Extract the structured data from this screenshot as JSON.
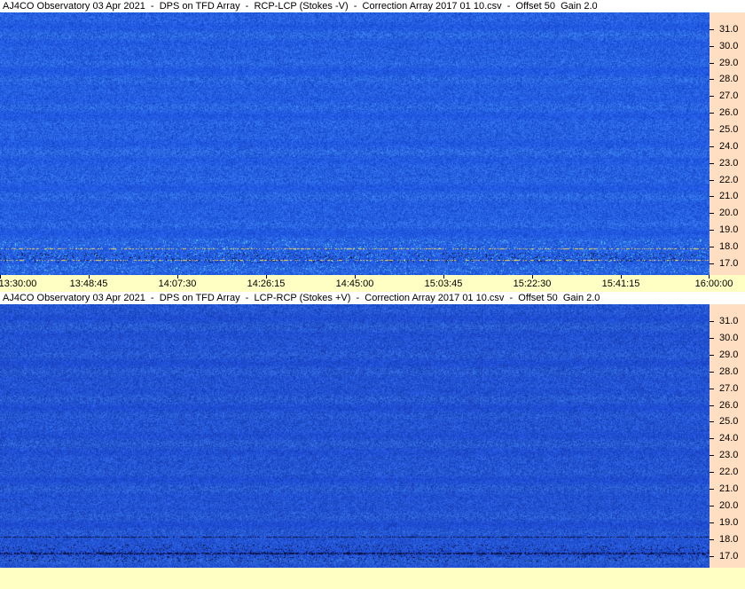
{
  "panels": [
    {
      "title": "AJ4CO Observatory 03 Apr 2021  -  DPS on TFD Array  -  RCP-LCP (Stokes -V)  -  Correction Array 2017 01 10.csv  -  Offset 50  Gain 2.0"
    },
    {
      "title": "AJ4CO Observatory 03 Apr 2021  -  DPS on TFD Array  -  LCP-RCP (Stokes +V)  -  Correction Array 2017 01 10.csv  -  Offset 50  Gain 2.0"
    }
  ],
  "chart_data": [
    {
      "type": "heatmap",
      "title": "AJ4CO Observatory 03 Apr 2021  -  DPS on TFD Array  -  RCP-LCP (Stokes -V)  -  Correction Array 2017 01 10.csv  -  Offset 50  Gain 2.0",
      "y_ticks": [
        "31.0",
        "30.0",
        "29.0",
        "28.0",
        "27.0",
        "26.0",
        "25.0",
        "24.0",
        "23.0",
        "22.0",
        "21.0",
        "20.0",
        "19.0",
        "18.0",
        "17.0"
      ],
      "y_values": [
        31,
        30,
        29,
        28,
        27,
        26,
        25,
        24,
        23,
        22,
        21,
        20,
        19,
        18,
        17
      ],
      "x_ticks": [
        "13:30:00",
        "13:48:45",
        "14:07:30",
        "14:26:15",
        "14:45:00",
        "15:03:45",
        "15:22:30",
        "15:41:15",
        "16:00:00"
      ],
      "ylim": [
        16.3,
        32.0
      ],
      "colors": {
        "base": "#1b52d9",
        "emission": "#5fc8f0",
        "strong": "#ffd24a"
      }
    },
    {
      "type": "heatmap",
      "title": "AJ4CO Observatory 03 Apr 2021  -  DPS on TFD Array  -  LCP-RCP (Stokes +V)  -  Correction Array 2017 01 10.csv  -  Offset 50  Gain 2.0",
      "y_ticks": [
        "31.0",
        "30.0",
        "29.0",
        "28.0",
        "27.0",
        "26.0",
        "25.0",
        "24.0",
        "23.0",
        "22.0",
        "21.0",
        "20.0",
        "19.0",
        "18.0",
        "17.0"
      ],
      "y_values": [
        31,
        30,
        29,
        28,
        27,
        26,
        25,
        24,
        23,
        22,
        21,
        20,
        19,
        18,
        17
      ],
      "x_ticks": [],
      "ylim": [
        16.3,
        32.0
      ],
      "colors": {
        "base": "#1a4cc8",
        "emission": "#2a75e6",
        "dark": "#0a1660"
      }
    }
  ]
}
